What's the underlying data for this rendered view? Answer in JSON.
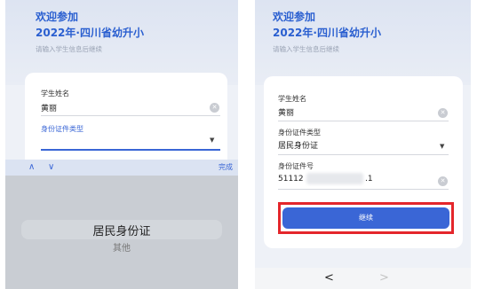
{
  "left": {
    "welcome": "欢迎参加",
    "event": "2022年·四川省幼升小",
    "hint": "请输入学生信息后继续",
    "fields": {
      "name_label": "学生姓名",
      "name_value": "黄丽",
      "idtype_label": "身份证件类型"
    },
    "toolbar": {
      "up": "∧",
      "down": "∨",
      "done": "完成"
    },
    "picker": {
      "selected": "居民身份证",
      "other": "其他"
    }
  },
  "right": {
    "welcome": "欢迎参加",
    "event": "2022年·四川省幼升小",
    "hint": "请输入学生信息后继续",
    "fields": {
      "name_label": "学生姓名",
      "name_value": "黄丽",
      "idtype_label": "身份证件类型",
      "idtype_value": "居民身份证",
      "idnum_label": "身份证件号",
      "idnum_prefix": "51112",
      "idnum_suffix": ".1"
    },
    "submit": "继续",
    "nav": {
      "back": "<",
      "forward": ">"
    }
  },
  "colors": {
    "accent": "#3a66d6",
    "highlight": "#e4262b"
  }
}
